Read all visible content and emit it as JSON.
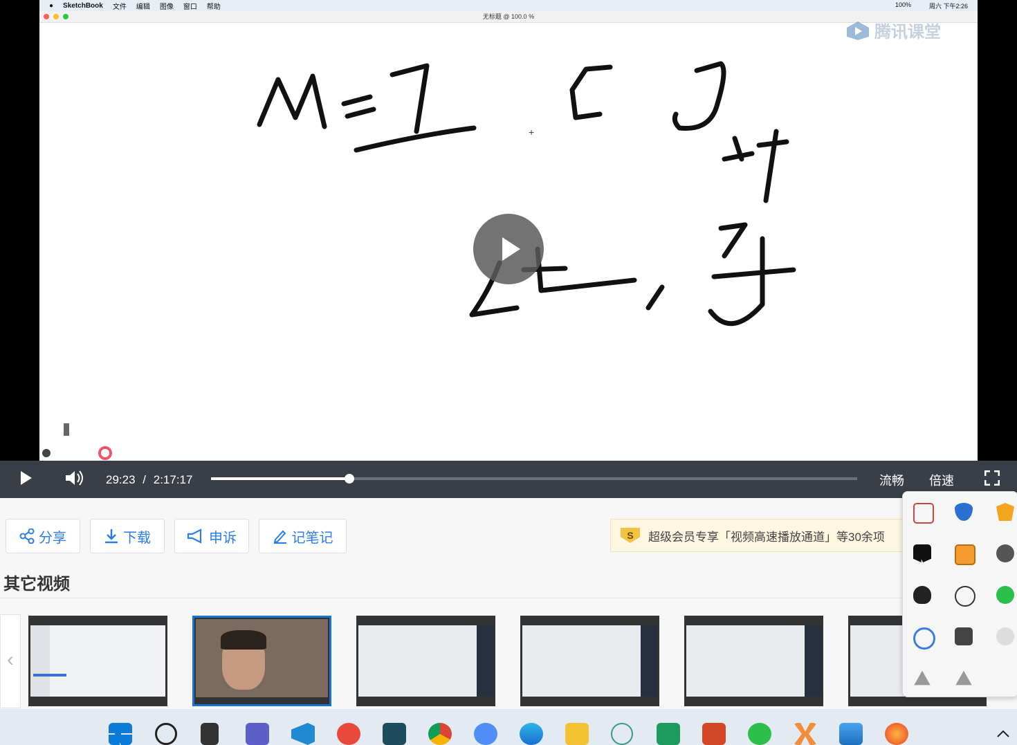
{
  "mac_menubar": {
    "app": "SketchBook",
    "menus": [
      "文件",
      "编辑",
      "图像",
      "窗口",
      "帮助"
    ],
    "status": [
      "100%",
      "周六 下午2:26"
    ]
  },
  "window_title": "无标题 @ 100.0 %",
  "watermark": "腾讯课堂",
  "player": {
    "current_time": "29:23",
    "separator": "/",
    "duration": "2:17:17",
    "progress": 0.2145,
    "quality": "流畅",
    "speed": "倍速"
  },
  "actions": {
    "share": "分享",
    "download": "下载",
    "report": "申诉",
    "notes": "记笔记"
  },
  "promo": {
    "badge": "S",
    "text": "超级会员专享「视频高速播放通道」等30余项"
  },
  "other_videos": {
    "title": "其它视频",
    "thumbs": [
      "code-editor",
      "webcam",
      "desktop",
      "document",
      "document",
      "desktop"
    ],
    "selected_index": 1
  },
  "tray_icons": [
    "screenshot-tool",
    "shield-blocked",
    "norton",
    "bookmark-app",
    "window-app",
    "cloud-blocked",
    "qq-blocked",
    "grammarly",
    "wechat",
    "tick-app",
    "striped-app",
    "globe",
    "drive",
    "drive"
  ],
  "taskbar_icons": [
    "windows-start",
    "search",
    "task-view",
    "teams",
    "vscode",
    "swirl-app",
    "qr-app",
    "chrome",
    "baidu-netdisk",
    "edge",
    "file-explorer",
    "weiyun",
    "pycharm",
    "powerpoint",
    "wechat",
    "xmind",
    "photos",
    "firefox"
  ],
  "colors": {
    "accent": "#2b7de9",
    "controls_bg": "#3a3f47",
    "selected_border": "#1672d4"
  }
}
